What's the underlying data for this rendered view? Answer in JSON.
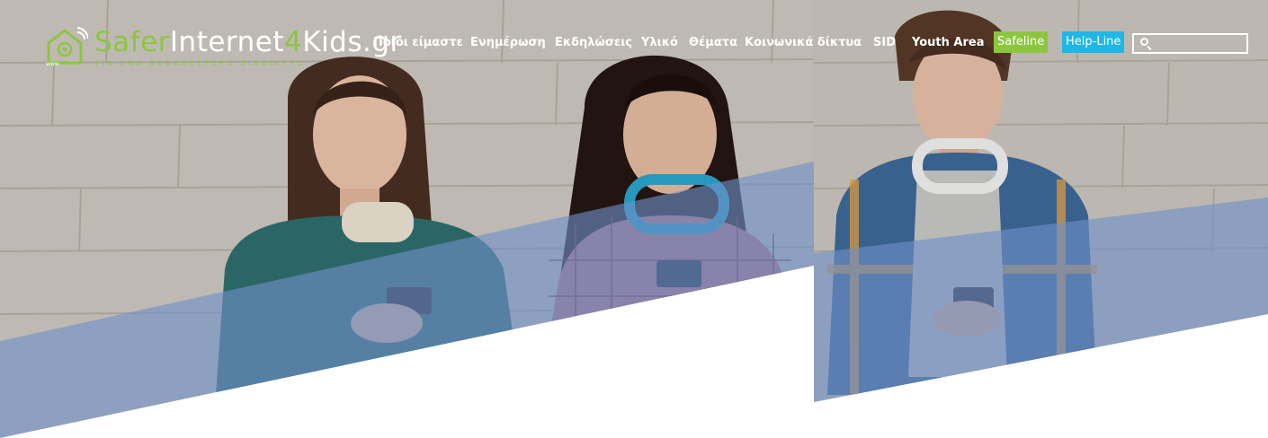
{
  "logo": {
    "part_green": "Safer",
    "part_white_1": "Internet",
    "part_green_2": "4",
    "part_white_2": "Kids.gr",
    "tagline": "ΓΙΑ ΕΝΑ ΑΣΦΑΛΕΣΤΕΡΟ ΔΙΑΔΙΚΤΥΟ",
    "icon_text": "www"
  },
  "nav": {
    "items": [
      {
        "label": "Ποιοι είμαστε"
      },
      {
        "label": "Ενημέρωση"
      },
      {
        "label": "Εκδηλώσεις"
      },
      {
        "label": "Υλικό"
      },
      {
        "label": "Θέματα"
      },
      {
        "label": "Κοινωνικά δίκτυα"
      },
      {
        "label": "SID"
      },
      {
        "label": "Youth Area"
      }
    ],
    "safeline": "Safeline",
    "helpline": "Help-Line"
  },
  "search": {
    "placeholder": ""
  },
  "colors": {
    "brand_green": "#8cc63f",
    "helpline_blue": "#1eb8e8",
    "overlay_blue": "#6f8fc8"
  }
}
